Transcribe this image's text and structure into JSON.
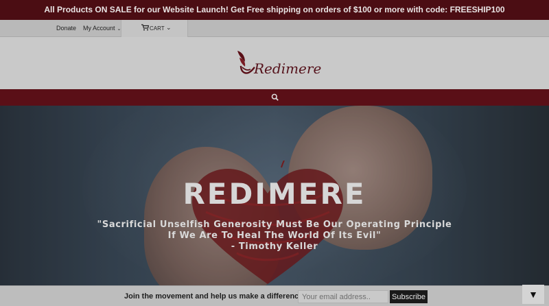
{
  "announcement": "All Products ON SALE for our Website Launch! Get Free shipping on orders of $100 or more with code: FREESHIP100",
  "topbar": {
    "donate_label": "Donate",
    "account_label": "My Account",
    "cart_label": "CART"
  },
  "brand": {
    "logo_text": "Redimere"
  },
  "hero": {
    "title": "REDIMERE",
    "quote_line1": "\"Sacrificial Unselfish Generosity Must Be Our Operating Principle",
    "quote_line2": "If We Are To Heal The World Of Its Evil\"",
    "quote_line3": "- Timothy Keller"
  },
  "newsletter": {
    "cta_text": "Join the movement and help us make a difference",
    "email_placeholder": "Your email address..",
    "subscribe_label": "Subscribe",
    "toggle_glyph": "▼"
  },
  "colors": {
    "brand_dark_red": "#4b0d13",
    "nav_red": "#5a0f17",
    "logo_red": "#55121b"
  },
  "icons": [
    "chevron-down-icon",
    "cart-icon",
    "search-icon",
    "logo-mark-icon"
  ]
}
